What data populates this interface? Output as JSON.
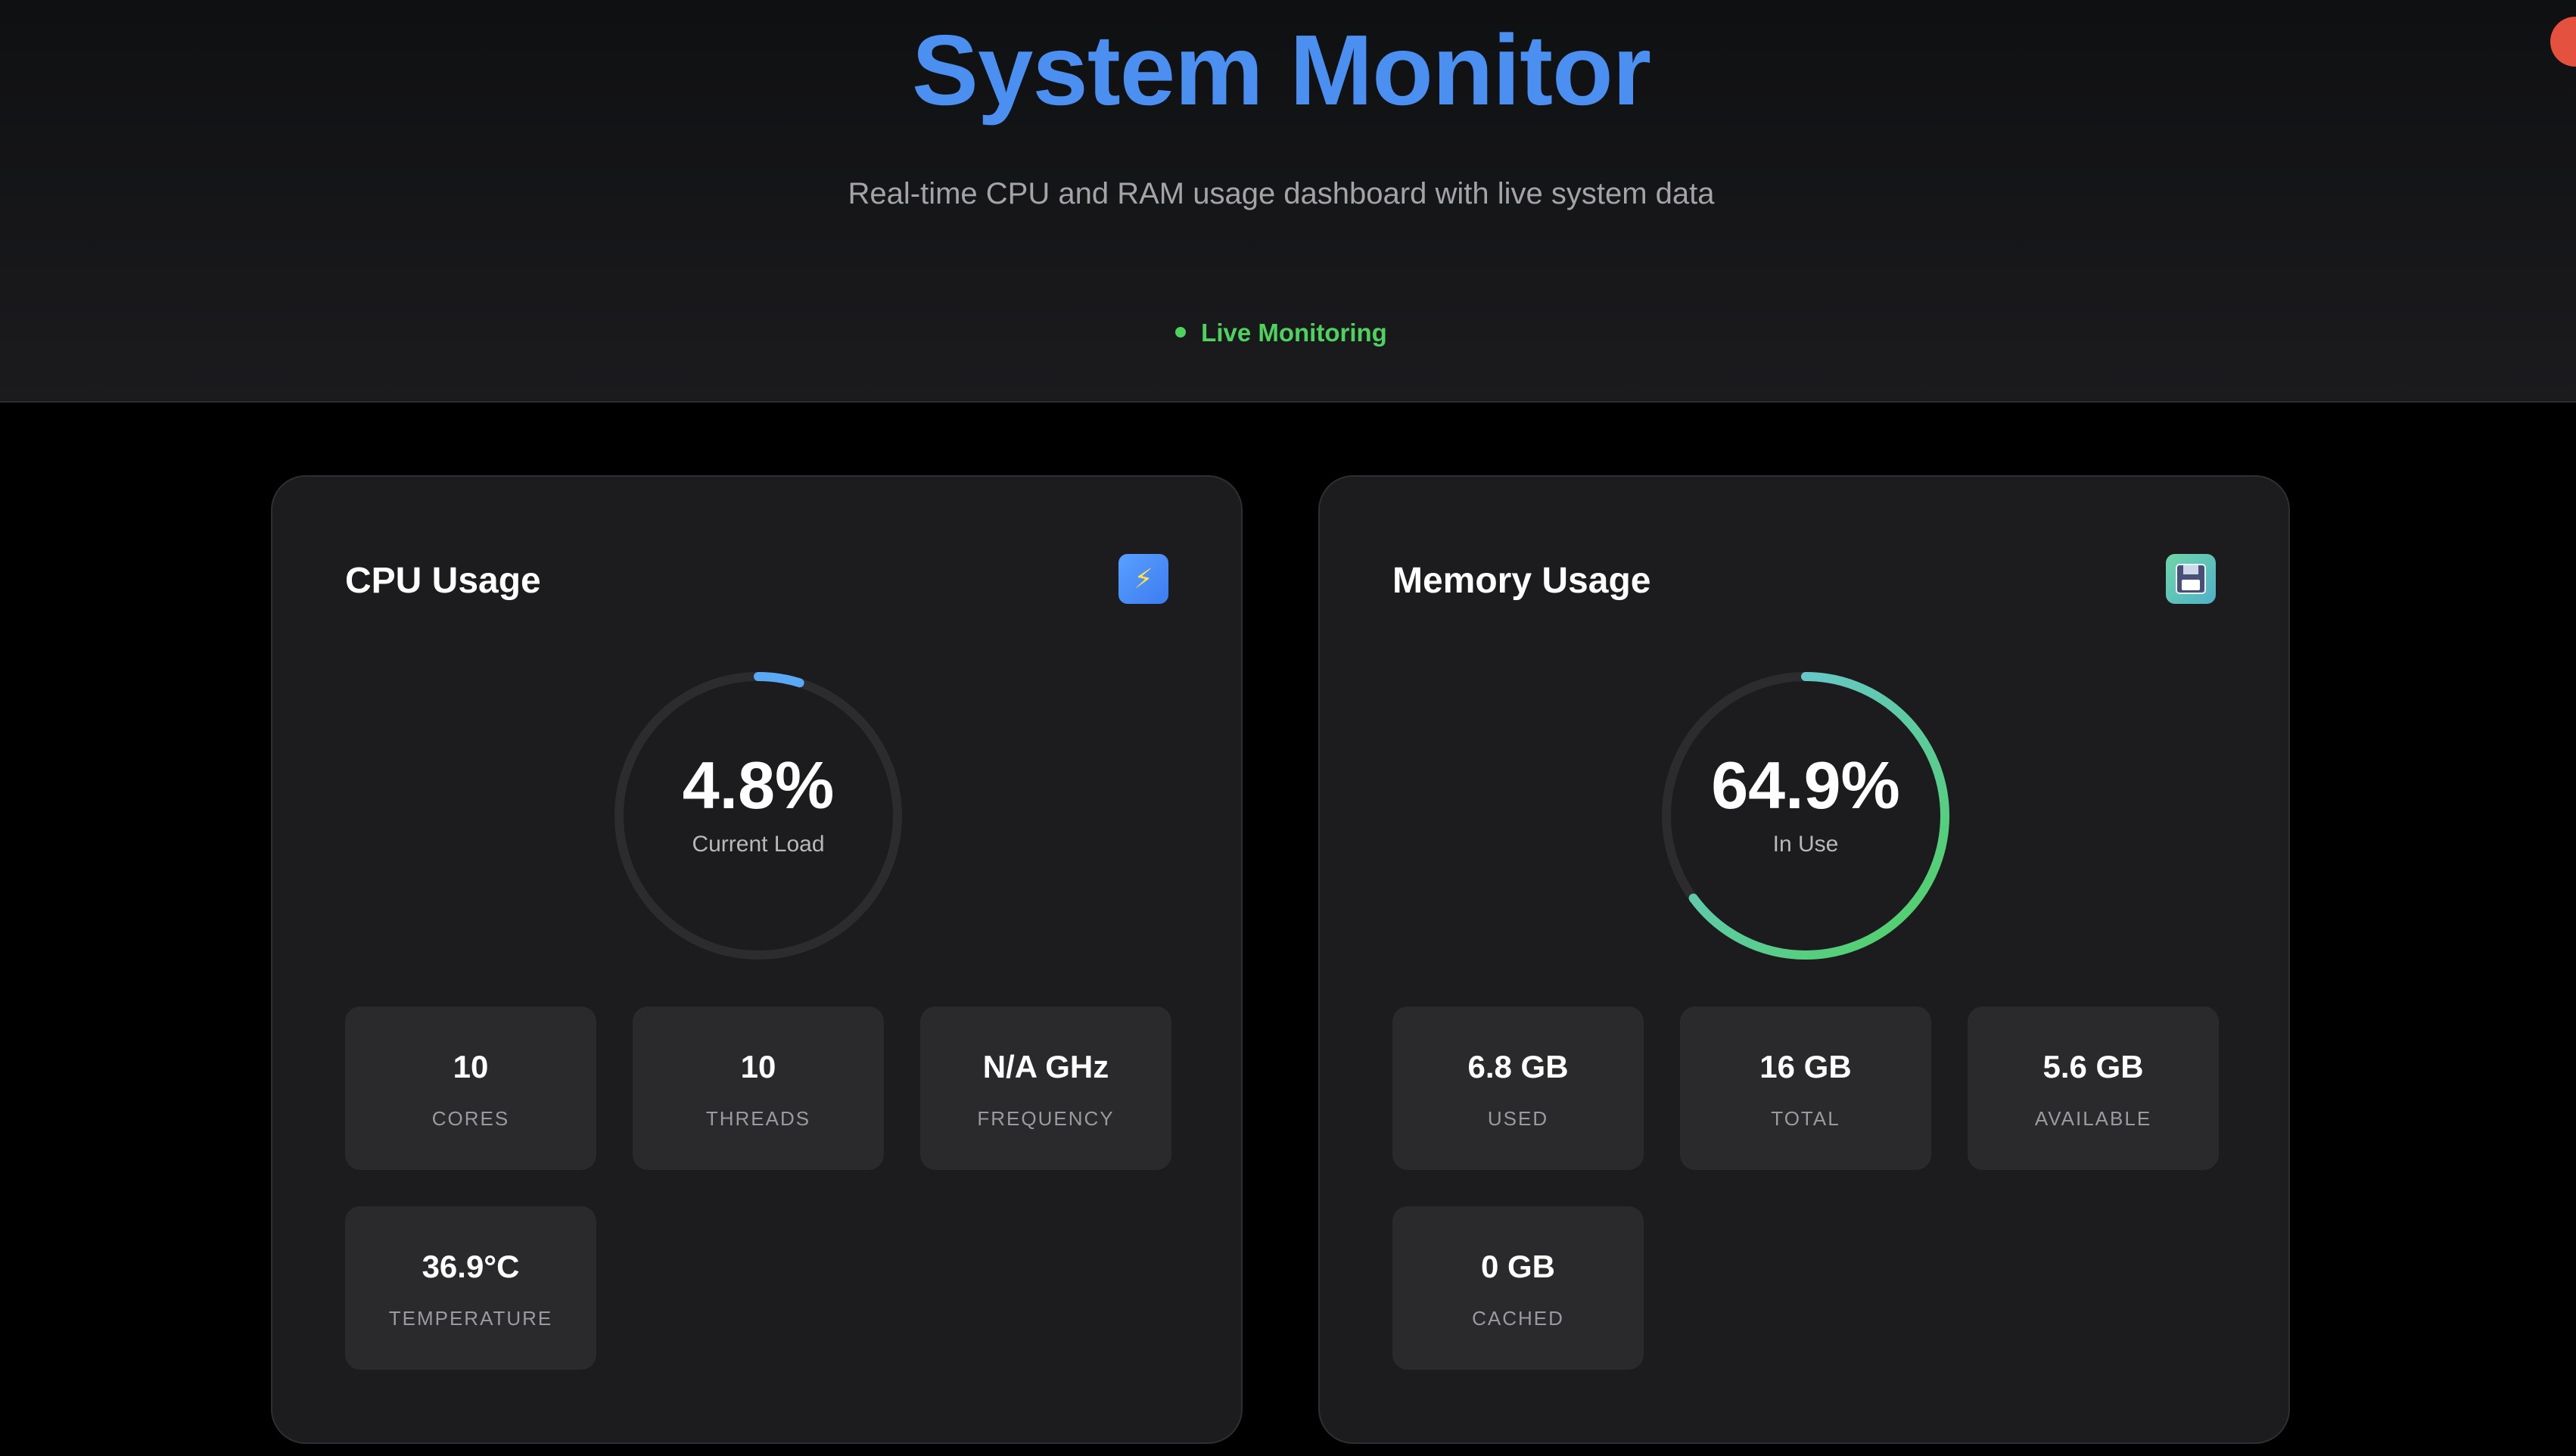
{
  "header": {
    "title": "System Monitor",
    "subtitle": "Real-time CPU and RAM usage dashboard with live system data",
    "status": "Live Monitoring",
    "accent_color": "#4b8ff0",
    "status_color": "#4fd15f"
  },
  "cpu": {
    "title": "CPU Usage",
    "icon": "lightning-icon",
    "icon_glyph": "⚡",
    "gauge_value": "4.8%",
    "gauge_label": "Current Load",
    "gauge_fraction": 0.048,
    "gauge_color": "#5aa9f5",
    "stats": [
      {
        "value": "10",
        "label": "CORES"
      },
      {
        "value": "10",
        "label": "THREADS"
      },
      {
        "value": "N/A GHz",
        "label": "FREQUENCY"
      },
      {
        "value": "36.9°C",
        "label": "TEMPERATURE"
      }
    ]
  },
  "memory": {
    "title": "Memory Usage",
    "icon": "floppy-disk-icon",
    "gauge_value": "64.9%",
    "gauge_label": "In Use",
    "gauge_fraction": 0.649,
    "gauge_color_start": "#6ec5e8",
    "gauge_color_end": "#4fd15f",
    "stats": [
      {
        "value": "6.8 GB",
        "label": "USED"
      },
      {
        "value": "16 GB",
        "label": "TOTAL"
      },
      {
        "value": "5.6 GB",
        "label": "AVAILABLE"
      },
      {
        "value": "0 GB",
        "label": "CACHED"
      }
    ]
  }
}
